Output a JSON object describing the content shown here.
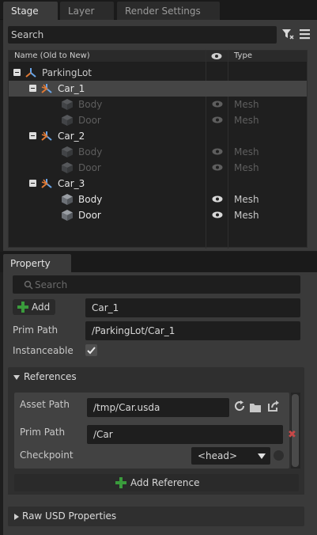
{
  "stage": {
    "tabs": [
      "Stage",
      "Layer",
      "Render Settings"
    ],
    "active_tab": "Stage",
    "search_value": "Search",
    "columns": {
      "name": "Name (Old to New)",
      "type": "Type"
    },
    "rows": [
      {
        "label": "ParkingLot",
        "type": "",
        "kind": "xform-root",
        "visible": false,
        "dim": false,
        "selected": false,
        "expander": true
      },
      {
        "label": "Car_1",
        "type": "",
        "kind": "xform",
        "visible": false,
        "dim": false,
        "selected": true,
        "expander": true
      },
      {
        "label": "Body",
        "type": "Mesh",
        "kind": "mesh",
        "visible": true,
        "dim": true,
        "selected": false,
        "expander": false
      },
      {
        "label": "Door",
        "type": "Mesh",
        "kind": "mesh",
        "visible": true,
        "dim": true,
        "selected": false,
        "expander": false
      },
      {
        "label": "Car_2",
        "type": "",
        "kind": "xform",
        "visible": false,
        "dim": false,
        "selected": false,
        "expander": true
      },
      {
        "label": "Body",
        "type": "Mesh",
        "kind": "mesh",
        "visible": true,
        "dim": true,
        "selected": false,
        "expander": false
      },
      {
        "label": "Door",
        "type": "Mesh",
        "kind": "mesh",
        "visible": true,
        "dim": true,
        "selected": false,
        "expander": false
      },
      {
        "label": "Car_3",
        "type": "",
        "kind": "xform",
        "visible": false,
        "dim": false,
        "selected": false,
        "expander": true
      },
      {
        "label": "Body",
        "type": "Mesh",
        "kind": "mesh",
        "visible": true,
        "dim": false,
        "selected": false,
        "expander": false
      },
      {
        "label": "Door",
        "type": "Mesh",
        "kind": "mesh",
        "visible": true,
        "dim": false,
        "selected": false,
        "expander": false
      }
    ]
  },
  "property": {
    "tab": "Property",
    "search_placeholder": "Search",
    "add_label": "Add",
    "prim_name": "Car_1",
    "prim_path_label": "Prim Path",
    "prim_path_value": "/ParkingLot/Car_1",
    "instanceable_label": "Instanceable",
    "instanceable_checked": true,
    "references": {
      "title": "References",
      "asset_path_label": "Asset Path",
      "asset_path_value": "/tmp/Car.usda",
      "prim_path_label": "Prim Path",
      "prim_path_value": "/Car",
      "checkpoint_label": "Checkpoint",
      "checkpoint_value": "<head>",
      "add_reference_label": "Add Reference"
    },
    "raw_usd_title": "Raw USD Properties"
  },
  "colors": {
    "accent_green": "#3a9b3c",
    "delete_red": "#c84848",
    "xform_blue": "#4a90d9",
    "xform_orange": "#e07a35"
  },
  "icons": [
    "filter-icon",
    "menu-icon",
    "eye-icon",
    "xform-icon",
    "mesh-cube-icon",
    "search-icon",
    "plus-icon",
    "check-icon",
    "reload-icon",
    "folder-icon",
    "open-external-icon",
    "delete-icon",
    "dropdown-arrow-icon"
  ]
}
